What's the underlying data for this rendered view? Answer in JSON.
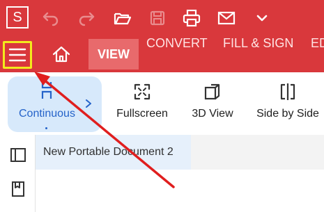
{
  "app": {
    "logo_letter": "S",
    "accent_color": "#d9383c",
    "highlight_color": "#f2ea1c"
  },
  "quick_access": {
    "icons": [
      "undo-icon",
      "redo-icon",
      "open-folder-icon",
      "save-icon",
      "print-icon",
      "email-icon",
      "chevron-down-icon"
    ]
  },
  "ribbon_tabs": {
    "menu_icon": "hamburger-menu-icon",
    "home_icon": "home-icon",
    "tabs": [
      {
        "label": "VIEW",
        "active": true
      },
      {
        "label": "CONVERT",
        "active": false
      },
      {
        "label": "FILL & SIGN",
        "active": false
      },
      {
        "label": "ED",
        "active": false
      }
    ]
  },
  "ribbon_tools": [
    {
      "label": "Continuous",
      "icon": "continuous-scroll-icon",
      "selected": true
    },
    {
      "label": "Fullscreen",
      "icon": "fullscreen-icon",
      "selected": false
    },
    {
      "label": "3D View",
      "icon": "3d-view-icon",
      "selected": false
    },
    {
      "label": "Side by Side",
      "icon": "side-by-side-icon",
      "selected": false
    }
  ],
  "side_panel": {
    "icons": [
      "panel-toggle-icon",
      "bookmark-icon"
    ]
  },
  "document": {
    "tab_title": "New Portable Document 2"
  },
  "annotation": {
    "arrow_color": "#e01e1e"
  }
}
